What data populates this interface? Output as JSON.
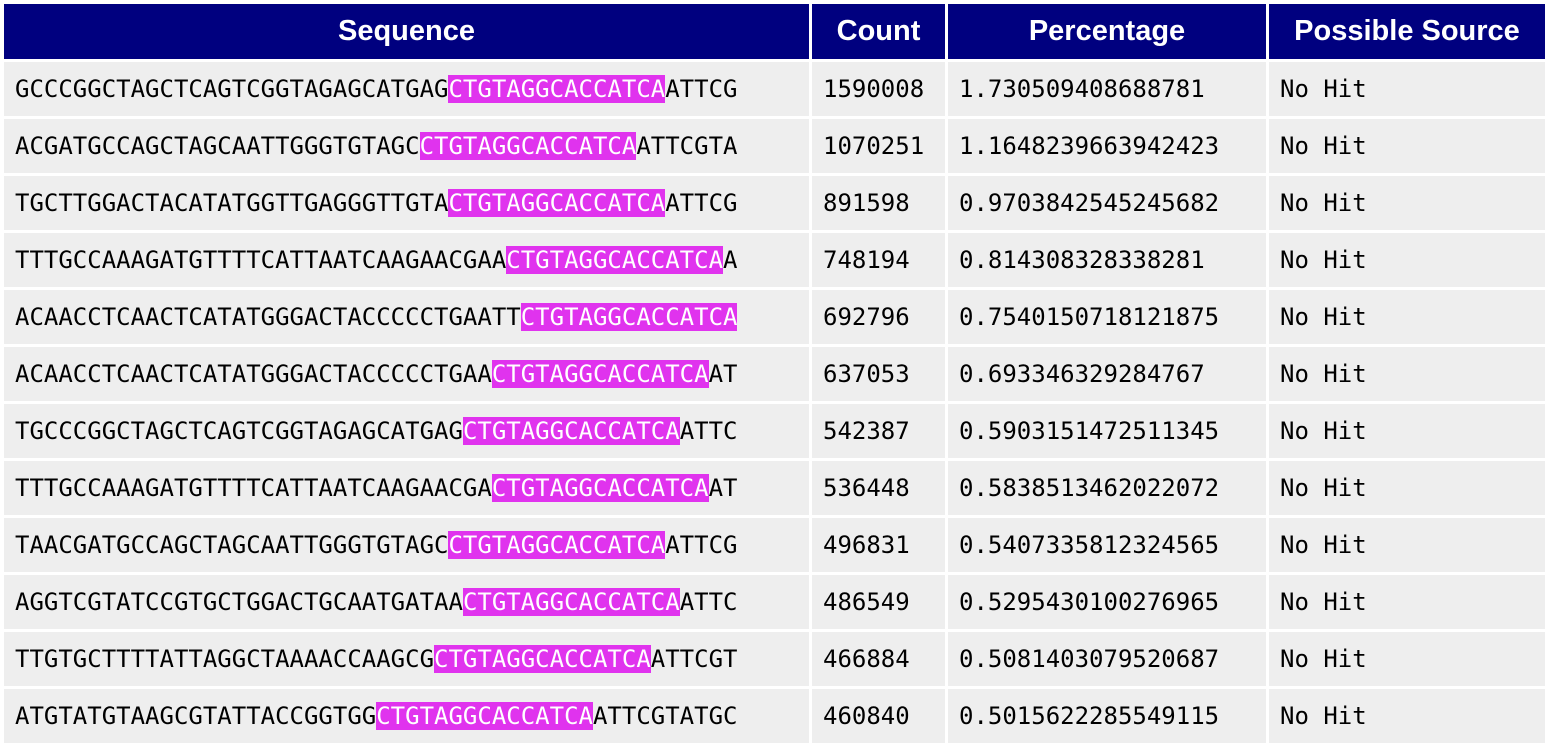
{
  "headers": [
    "Sequence",
    "Count",
    "Percentage",
    "Possible Source"
  ],
  "highlight_color": "#e033ee",
  "header_color": "#00007f",
  "rows": [
    {
      "pre": "GCCCGGCTAGCTCAGTCGGTAGAGCATGAG",
      "hit": "CTGTAGGCACCATCA",
      "post": "ATTCG",
      "count": "1590008",
      "percentage": "1.730509408688781",
      "source": "No Hit"
    },
    {
      "pre": "ACGATGCCAGCTAGCAATTGGGTGTAGC",
      "hit": "CTGTAGGCACCATCA",
      "post": "ATTCGTA",
      "count": "1070251",
      "percentage": "1.1648239663942423",
      "source": "No Hit"
    },
    {
      "pre": "TGCTTGGACTACATATGGTTGAGGGTTGTA",
      "hit": "CTGTAGGCACCATCA",
      "post": "ATTCG",
      "count": "891598",
      "percentage": "0.9703842545245682",
      "source": "No Hit"
    },
    {
      "pre": "TTTGCCAAAGATGTTTTCATTAATCAAGAACGAA",
      "hit": "CTGTAGGCACCATCA",
      "post": "A",
      "count": "748194",
      "percentage": "0.814308328338281",
      "source": "No Hit"
    },
    {
      "pre": "ACAACCTCAACTCATATGGGACTACCCCCTGAATT",
      "hit": "CTGTAGGCACCATCA",
      "post": "",
      "count": "692796",
      "percentage": "0.7540150718121875",
      "source": "No Hit"
    },
    {
      "pre": "ACAACCTCAACTCATATGGGACTACCCCCTGAA",
      "hit": "CTGTAGGCACCATCA",
      "post": "AT",
      "count": "637053",
      "percentage": "0.693346329284767",
      "source": "No Hit"
    },
    {
      "pre": "TGCCCGGCTAGCTCAGTCGGTAGAGCATGAG",
      "hit": "CTGTAGGCACCATCA",
      "post": "ATTC",
      "count": "542387",
      "percentage": "0.5903151472511345",
      "source": "No Hit"
    },
    {
      "pre": "TTTGCCAAAGATGTTTTCATTAATCAAGAACGA",
      "hit": "CTGTAGGCACCATCA",
      "post": "AT",
      "count": "536448",
      "percentage": "0.5838513462022072",
      "source": "No Hit"
    },
    {
      "pre": "TAACGATGCCAGCTAGCAATTGGGTGTAGC",
      "hit": "CTGTAGGCACCATCA",
      "post": "ATTCG",
      "count": "496831",
      "percentage": "0.5407335812324565",
      "source": "No Hit"
    },
    {
      "pre": "AGGTCGTATCCGTGCTGGACTGCAATGATAA",
      "hit": "CTGTAGGCACCATCA",
      "post": "ATTC",
      "count": "486549",
      "percentage": "0.5295430100276965",
      "source": "No Hit"
    },
    {
      "pre": "TTGTGCTTTTATTAGGCTAAAACCAAGCG",
      "hit": "CTGTAGGCACCATCA",
      "post": "ATTCGT",
      "count": "466884",
      "percentage": "0.5081403079520687",
      "source": "No Hit"
    },
    {
      "pre": "ATGTATGTAAGCGTATTACCGGTGG",
      "hit": "CTGTAGGCACCATCA",
      "post": "ATTCGTATGC",
      "count": "460840",
      "percentage": "0.5015622285549115",
      "source": "No Hit"
    }
  ]
}
